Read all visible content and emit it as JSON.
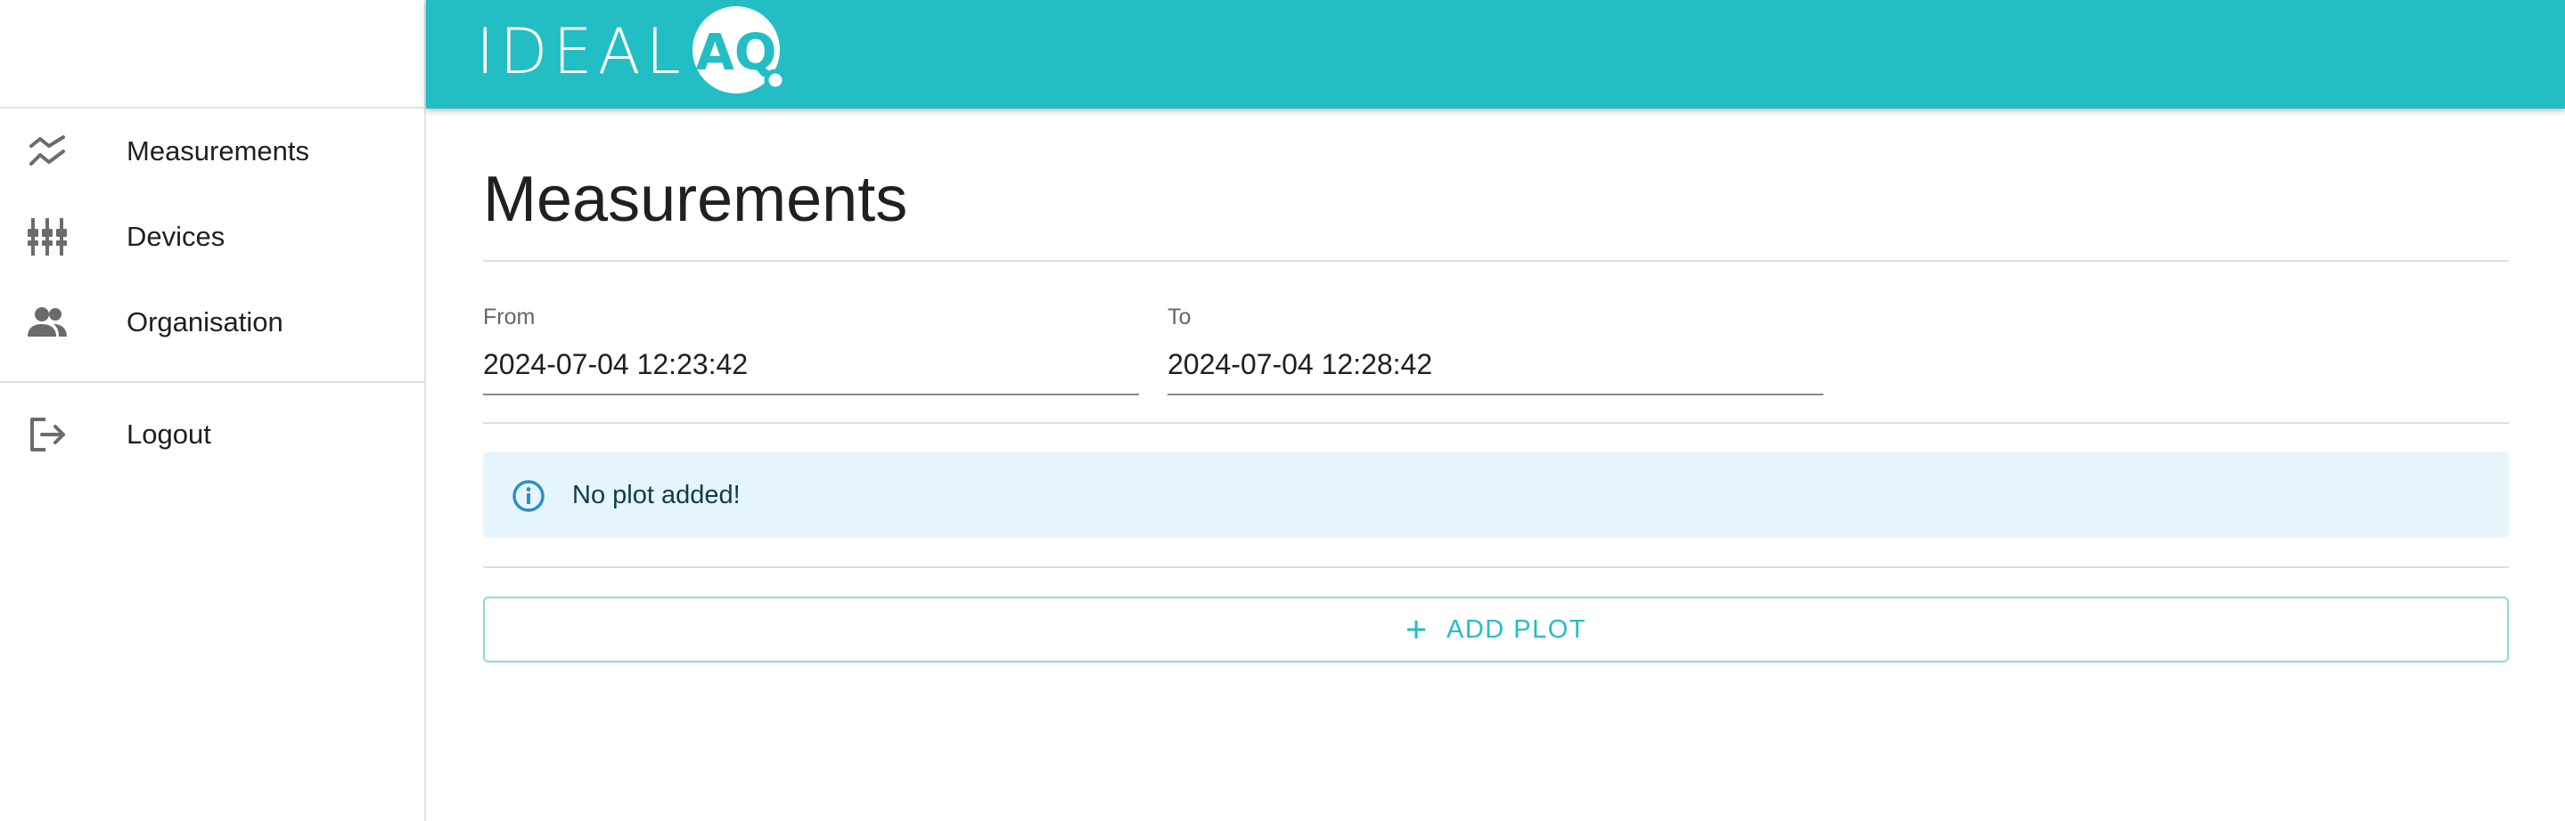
{
  "header": {
    "logo_text": "IDEAL",
    "logo_badge_text": "AQ",
    "brand_color": "#22bec4"
  },
  "sidebar": {
    "items": [
      {
        "label": "Measurements",
        "icon": "measurements-chart-icon"
      },
      {
        "label": "Devices",
        "icon": "devices-sliders-icon"
      },
      {
        "label": "Organisation",
        "icon": "people-icon"
      }
    ],
    "logout": {
      "label": "Logout",
      "icon": "logout-icon"
    }
  },
  "main": {
    "title": "Measurements",
    "from": {
      "label": "From",
      "value": "2024-07-04 12:23:42"
    },
    "to": {
      "label": "To",
      "value": "2024-07-04 12:28:42"
    },
    "info": {
      "text": "No plot added!",
      "icon": "info-icon"
    },
    "add_plot": {
      "label": "ADD PLOT",
      "icon": "plus-icon"
    }
  },
  "colors": {
    "accent": "#22bec4",
    "info_bg": "#e5f5fb",
    "info_icon": "#2a8fc7"
  }
}
